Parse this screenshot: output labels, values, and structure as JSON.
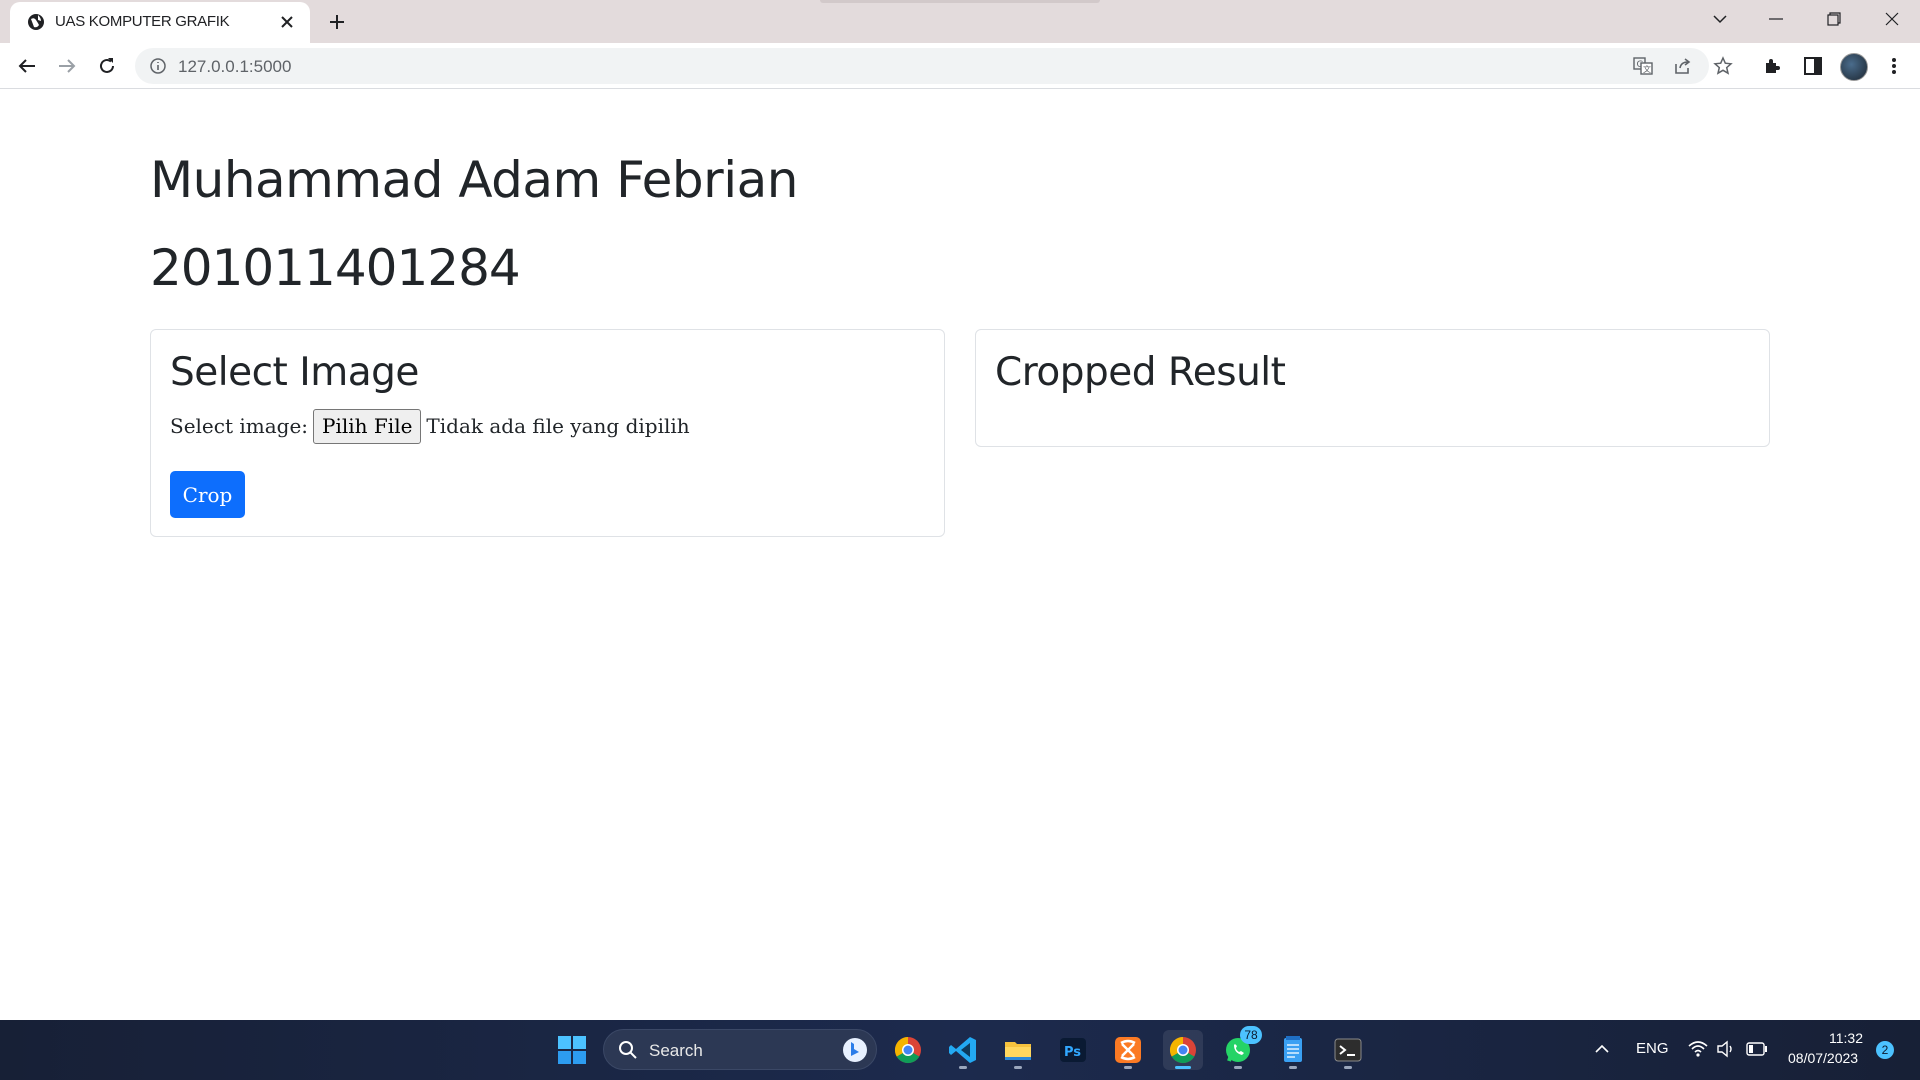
{
  "browser": {
    "tab_title": "UAS KOMPUTER GRAFIK",
    "url": "127.0.0.1:5000"
  },
  "page": {
    "name": "Muhammad Adam Febrian",
    "nim": "201011401284",
    "select_card": {
      "title": "Select Image",
      "field_label": "Select image:",
      "file_button": "Pilih File",
      "file_status": "Tidak ada file yang dipilih",
      "crop_button": "Crop"
    },
    "result_card": {
      "title": "Cropped Result"
    }
  },
  "taskbar": {
    "search_label": "Search",
    "whatsapp_badge": "78",
    "language": "ENG",
    "time": "11:32",
    "date": "08/07/2023",
    "notification_count": "2"
  },
  "colors": {
    "accent": "#0d6efd",
    "taskbar": "#1c2a4d"
  }
}
